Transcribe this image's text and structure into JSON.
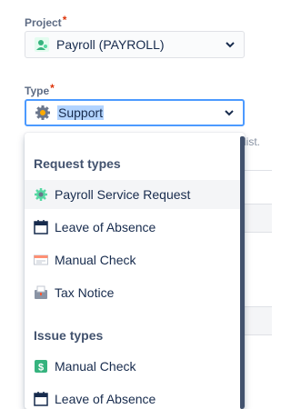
{
  "project_field": {
    "label": "Project",
    "required_mark": "*",
    "value": "Payroll (PAYROLL)",
    "icon": "project-avatar-icon"
  },
  "type_field": {
    "label": "Type",
    "required_mark": "*",
    "value": "Support",
    "icon": "gear-icon"
  },
  "background": {
    "hint_fragment": "list."
  },
  "dropdown": {
    "groups": [
      {
        "heading": "Request types",
        "options": [
          {
            "label": "Payroll Service Request",
            "icon": "gear-icon",
            "highlighted": true
          },
          {
            "label": "Leave of Absence",
            "icon": "calendar-icon",
            "highlighted": false
          },
          {
            "label": "Manual Check",
            "icon": "check-icon",
            "highlighted": false
          },
          {
            "label": "Tax Notice",
            "icon": "mailbox-icon",
            "highlighted": false
          }
        ]
      },
      {
        "heading": "Issue types",
        "options": [
          {
            "label": "Manual Check",
            "icon": "dollar-icon",
            "highlighted": false
          },
          {
            "label": "Leave of Absence",
            "icon": "calendar-icon",
            "highlighted": false
          }
        ]
      }
    ]
  }
}
